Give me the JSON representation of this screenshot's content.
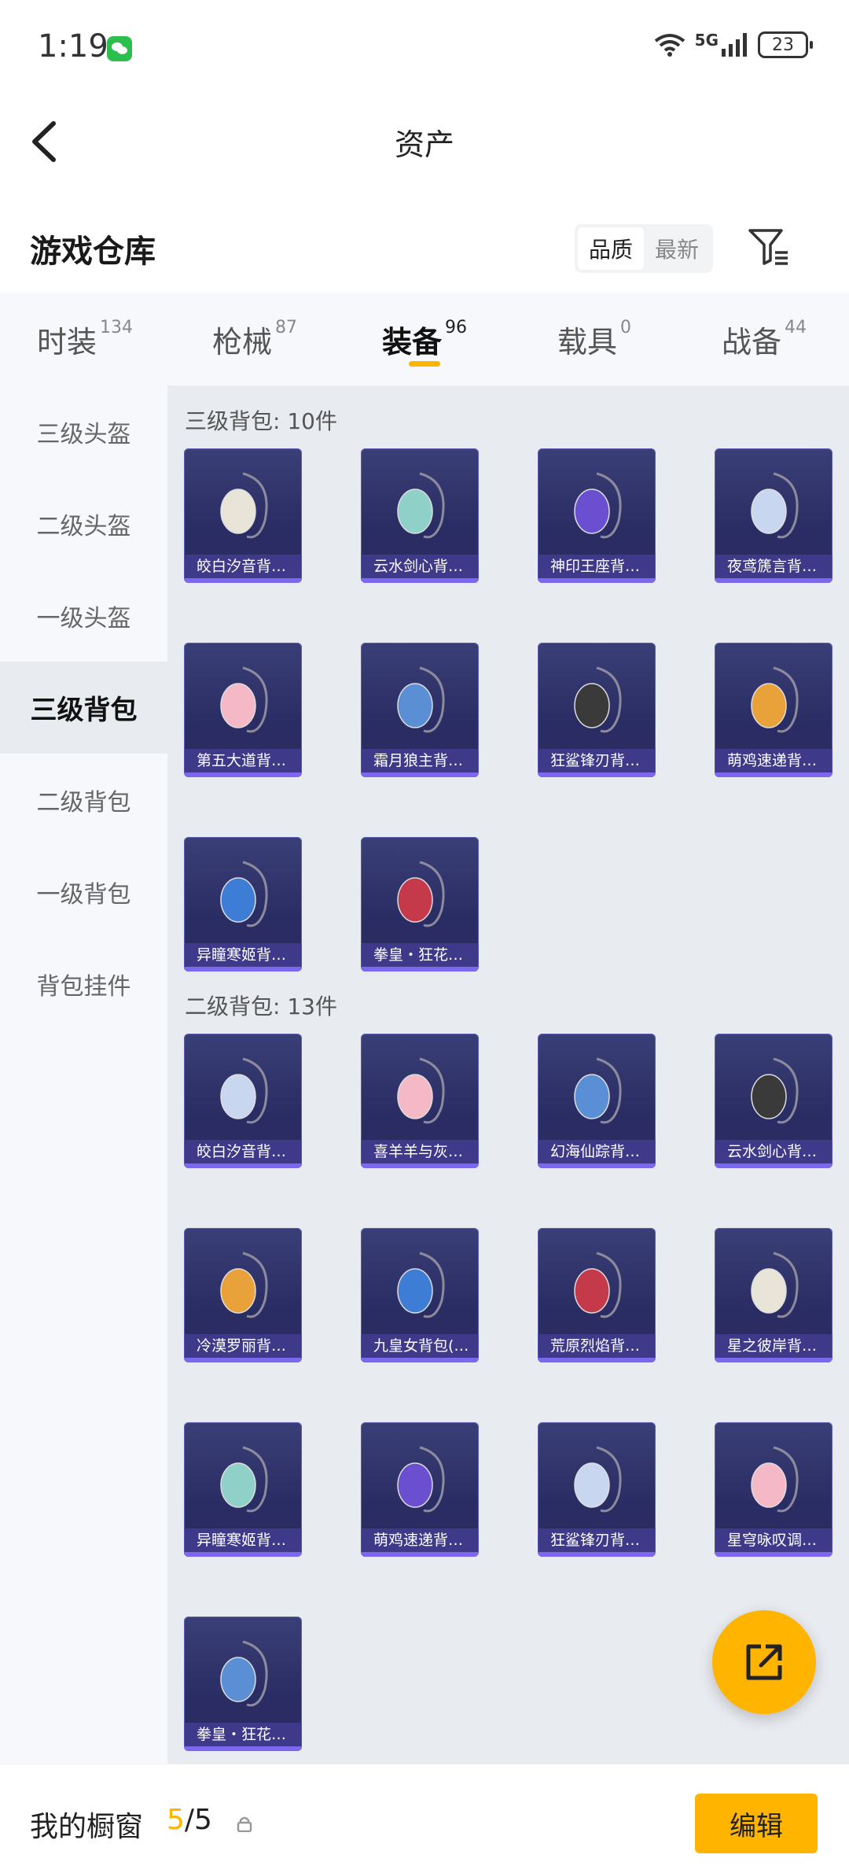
{
  "status_bar": {
    "time": "1:19",
    "network": "5G",
    "battery": "23"
  },
  "header": {
    "title": "资产"
  },
  "warehouse": {
    "title": "游戏仓库",
    "sort_options": [
      "品质",
      "最新"
    ]
  },
  "tabs": [
    {
      "label": "时装",
      "count": "134"
    },
    {
      "label": "枪械",
      "count": "87"
    },
    {
      "label": "装备",
      "count": "96",
      "active": true
    },
    {
      "label": "载具",
      "count": "0"
    },
    {
      "label": "战备",
      "count": "44"
    }
  ],
  "sidebar": {
    "items": [
      "三级头盔",
      "二级头盔",
      "一级头盔",
      "三级背包",
      "二级背包",
      "一级背包",
      "背包挂件"
    ],
    "active_index": 3
  },
  "sections": [
    {
      "title": "三级背包: 10件",
      "items": [
        "皎白汐音背…",
        "云水剑心背…",
        "神印王座背…",
        "夜鸢篪言背…",
        "第五大道背…",
        "霜月狼主背…",
        "狂鲨锋刃背…",
        "萌鸡速递背…",
        "异瞳寒姬背…",
        "拳皇・狂花…"
      ]
    },
    {
      "title": "二级背包: 13件",
      "items": [
        "皎白汐音背…",
        "喜羊羊与灰…",
        "幻海仙踪背…",
        "云水剑心背…",
        "冷漠罗丽背…",
        "九皇女背包(…",
        "荒原烈焰背…",
        "星之彼岸背…",
        "异瞳寒姬背…",
        "萌鸡速递背…",
        "狂鲨锋刃背…",
        "星穹咏叹调…",
        "拳皇・狂花…"
      ]
    }
  ],
  "bottom_bar": {
    "label": "我的橱窗",
    "current": "5",
    "total": "/5",
    "edit_label": "编辑"
  },
  "colors": {
    "accent": "#ffb400",
    "card_bg": "#2a2d63",
    "card_label_bg": "#5046aa"
  }
}
